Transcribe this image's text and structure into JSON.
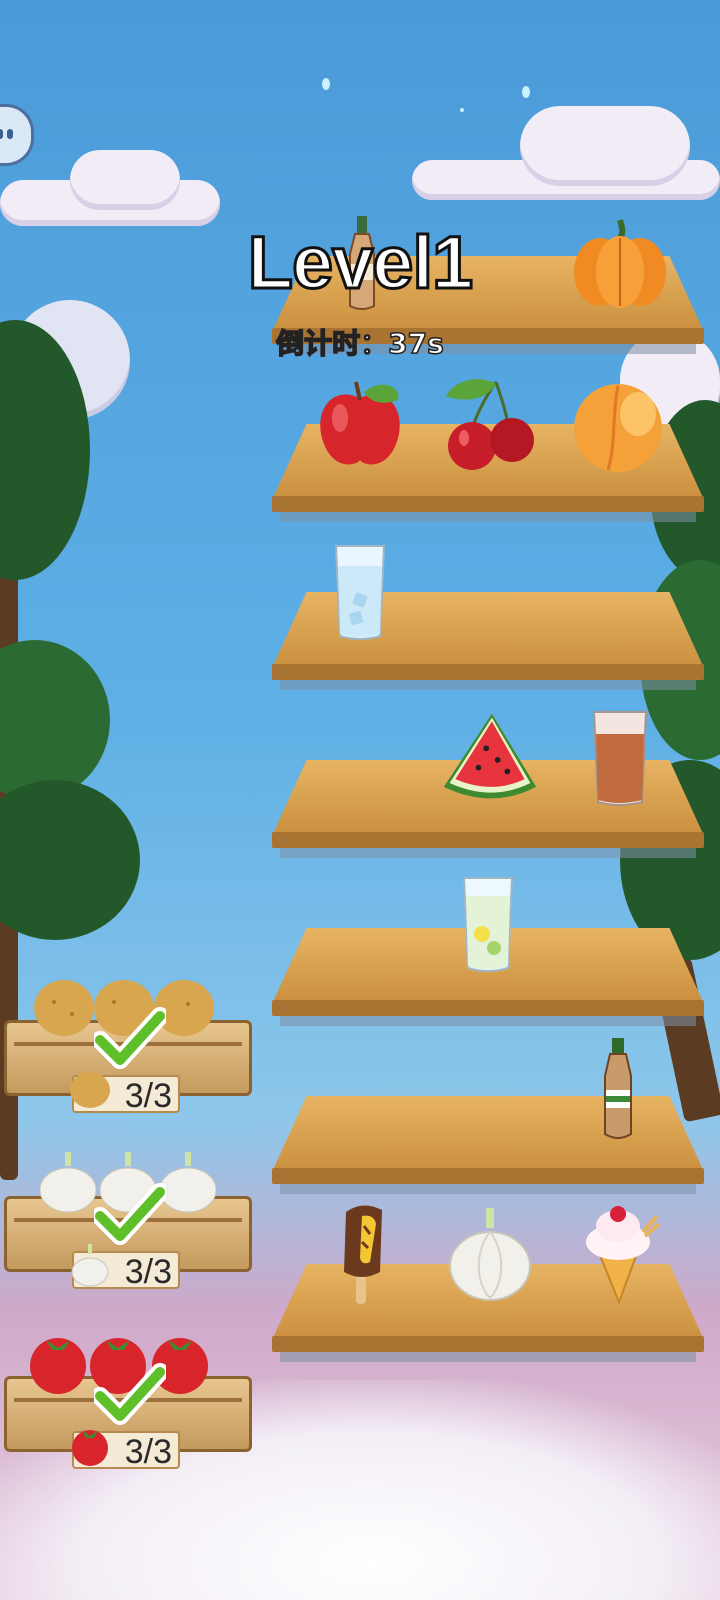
{
  "hud": {
    "level_title": "Level1",
    "countdown": "倒计时：37s",
    "pause_icon": "pause-icon"
  },
  "colors": {
    "sky_top": "#4a9ad8",
    "sky_bottom": "#cfa9c9",
    "shelf_wood": "#e0a957",
    "check_green": "#5fbf2a"
  },
  "shelves": [
    {
      "items": [
        "pumpkin"
      ]
    },
    {
      "items": [
        "apple",
        "cherries",
        "peach"
      ]
    },
    {
      "items": [
        "glass-of-water"
      ]
    },
    {
      "items": [
        "watermelon-slice",
        "glass-of-iced-tea"
      ]
    },
    {
      "items": [
        "glass-of-lemon-water"
      ]
    },
    {
      "items": [
        "soda-bottle"
      ]
    },
    {
      "items": [
        "chocolate-ice-cream-bar",
        "garlic",
        "ice-cream-cone"
      ]
    }
  ],
  "crates": [
    {
      "item": "potato",
      "progress": "3/3",
      "completed": true
    },
    {
      "item": "garlic",
      "progress": "3/3",
      "completed": true
    },
    {
      "item": "tomato",
      "progress": "3/3",
      "completed": true
    }
  ]
}
